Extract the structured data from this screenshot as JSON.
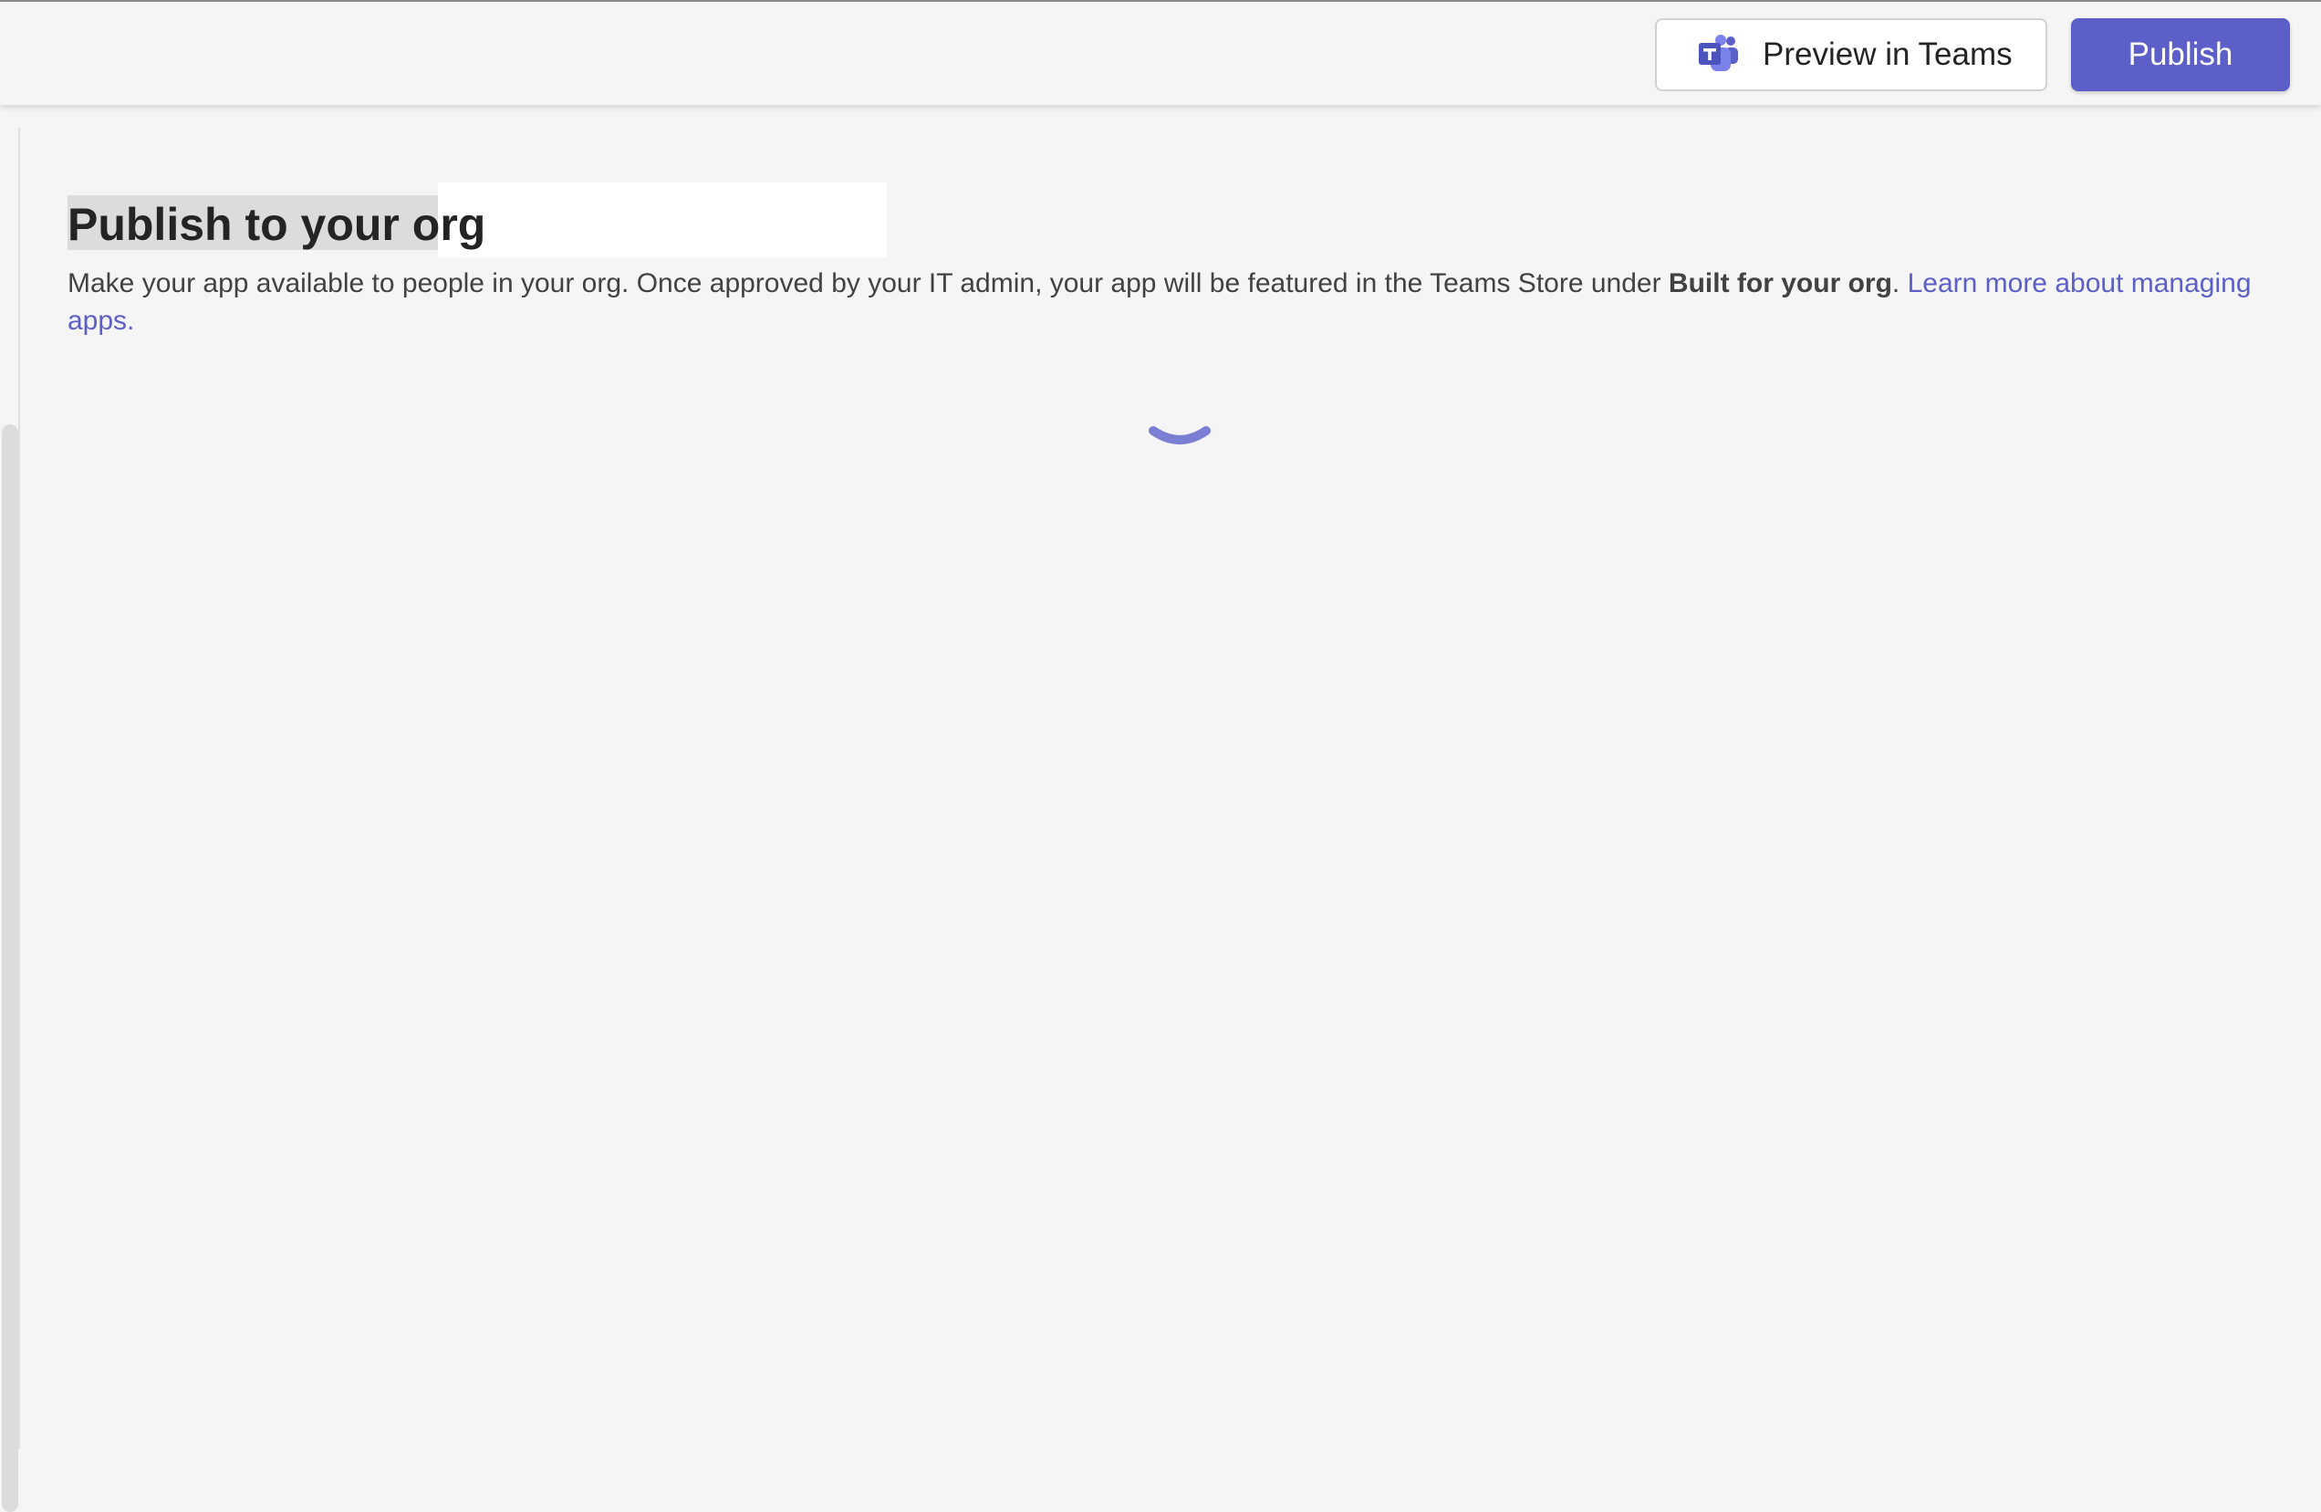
{
  "toolbar": {
    "preview_label": "Preview in Teams",
    "publish_label": "Publish"
  },
  "main": {
    "title": "Publish to your org",
    "description_before": "Make your app available to people in your org. Once approved by your IT admin, your app will be featured in the Teams Store under ",
    "description_bold": "Built for your org",
    "description_after": ". ",
    "learn_more_link": "Learn more about managing apps."
  },
  "icons": {
    "teams": "teams-icon",
    "spinner": "loading-spinner"
  },
  "colors": {
    "accent": "#5b5fc7",
    "spinner": "#7a7fd4",
    "background": "#f5f5f5"
  }
}
